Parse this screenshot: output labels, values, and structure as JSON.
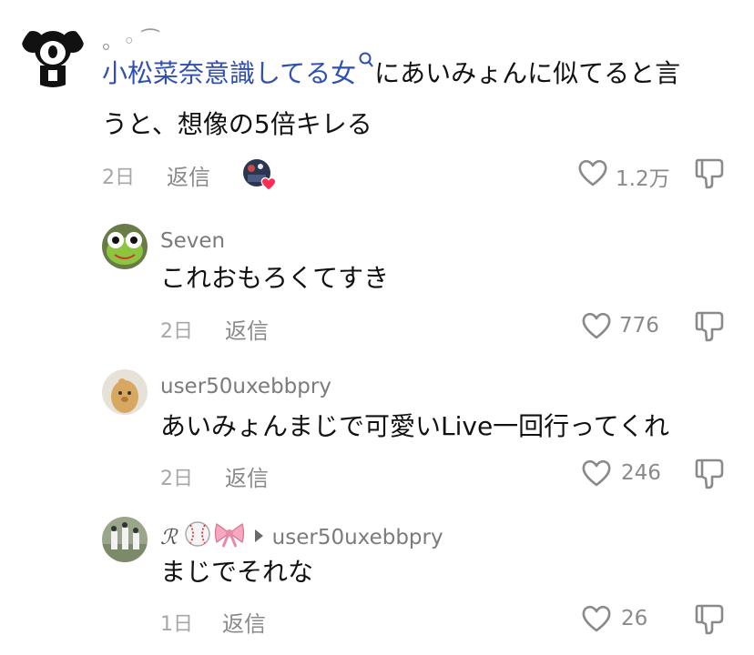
{
  "comments": [
    {
      "username": "。◦ ⁀",
      "mention": "小松菜奈意識してる女",
      "text_line1": "にあいみょんに似てると言",
      "text_line2": "うと、想像の5倍キレる",
      "time": "2日",
      "reply": "返信",
      "likes": "1.2万"
    },
    {
      "username": "Seven",
      "text": "これおもろくてすき",
      "time": "2日",
      "reply": "返信",
      "likes": "776"
    },
    {
      "username": "user50uxebbpry",
      "text": "あいみょんまじで可愛いLive一回行ってくれ",
      "time": "2日",
      "reply": "返信",
      "likes": "246"
    },
    {
      "username": "ℛ",
      "reply_to": "user50uxebbpry",
      "text": "まじでそれな",
      "time": "1日",
      "reply": "返信",
      "likes": "26"
    }
  ]
}
